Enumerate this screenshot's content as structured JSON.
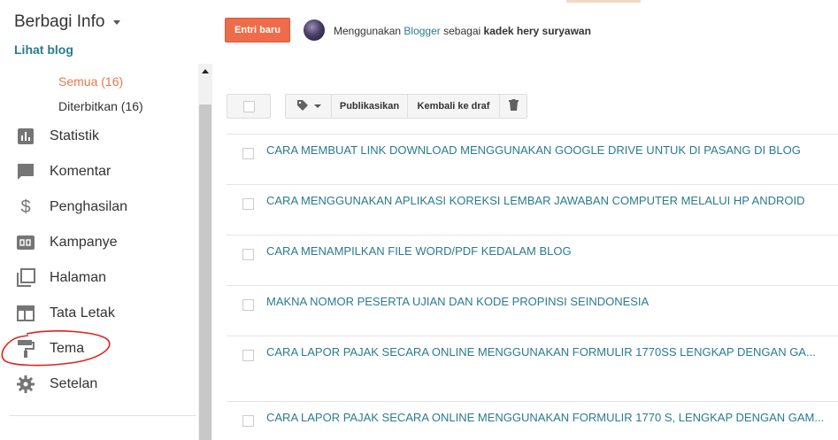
{
  "sidebar": {
    "blog_title": "Berbagi Info",
    "view_blog": "Lihat blog",
    "sub_items": [
      "Semua (16)",
      "Diterbitkan (16)"
    ],
    "nav": [
      {
        "label": "Statistik",
        "icon": "bar-chart-icon"
      },
      {
        "label": "Komentar",
        "icon": "comment-icon"
      },
      {
        "label": "Penghasilan",
        "icon": "dollar-icon"
      },
      {
        "label": "Kampanye",
        "icon": "ad-icon"
      },
      {
        "label": "Halaman",
        "icon": "pages-icon"
      },
      {
        "label": "Tata Letak",
        "icon": "layout-icon"
      },
      {
        "label": "Tema",
        "icon": "paint-roller-icon"
      },
      {
        "label": "Setelan",
        "icon": "gear-icon"
      }
    ]
  },
  "header": {
    "new_post": "Entri baru",
    "using_prefix": "Menggunakan",
    "blogger": "Blogger",
    "as_text": "sebagai",
    "user": "kadek hery suryawan"
  },
  "toolbar": {
    "publish": "Publikasikan",
    "revert_draft": "Kembali ke draf"
  },
  "posts": [
    "CARA MEMBUAT LINK DOWNLOAD MENGGUNAKAN GOOGLE DRIVE UNTUK DI PASANG DI BLOG",
    "CARA MENGGUNAKAN APLIKASI KOREKSI LEMBAR JAWABAN COMPUTER MELALUI HP ANDROID",
    "CARA MENAMPILKAN FILE WORD/PDF KEDALAM BLOG",
    "MAKNA NOMOR PESERTA UJIAN DAN KODE PROPINSI SEINDONESIA",
    "CARA LAPOR PAJAK SECARA ONLINE MENGGUNAKAN FORMULIR 1770SS LENGKAP DENGAN GA...",
    "CARA LAPOR PAJAK SECARA ONLINE MENGGUNAKAN FORMULIR 1770 S, LENGKAP DENGAN GAM..."
  ],
  "colors": {
    "accent_orange": "#ef6c4a",
    "link_teal": "#2a7b8e",
    "annotation_red": "#e0201b"
  }
}
